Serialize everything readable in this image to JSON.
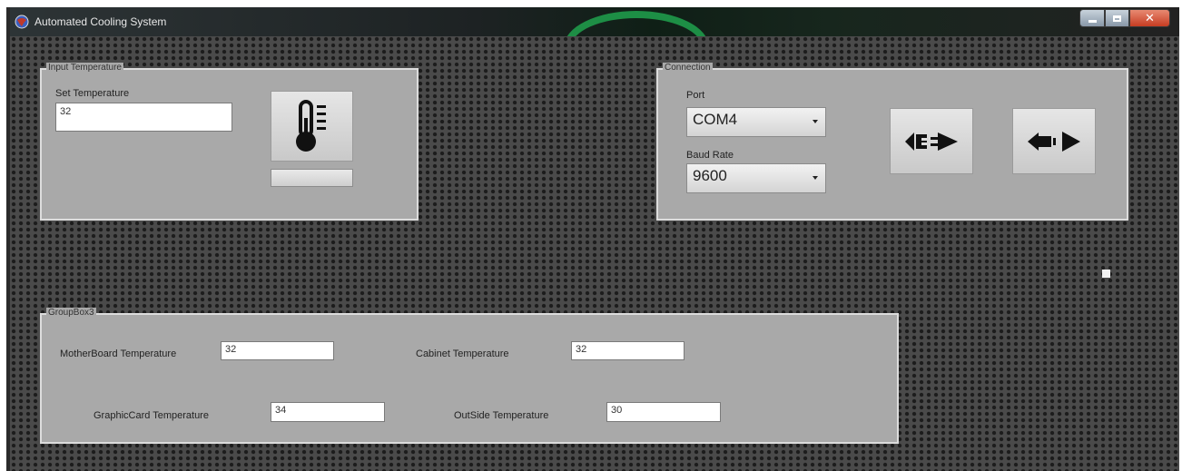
{
  "window": {
    "title": "Automated Cooling System",
    "icon": "app-globe-icon",
    "caption_buttons": [
      "minimize-icon",
      "maximize-icon",
      "close-icon"
    ]
  },
  "input_temperature": {
    "group_title": "Input Temperature",
    "set_label": "Set Temperature",
    "set_value": "32",
    "thermometer_icon": "thermometer-icon"
  },
  "connection": {
    "group_title": "Connection",
    "port_label": "Port",
    "port_value": "COM4",
    "baud_label": "Baud Rate",
    "baud_value": "9600",
    "connect_icon": "plug-connect-icon",
    "disconnect_icon": "plug-disconnect-icon"
  },
  "groupbox3": {
    "group_title": "GroupBox3",
    "motherboard_label": "MotherBoard Temperature",
    "motherboard_value": "32",
    "cabinet_label": "Cabinet Temperature",
    "cabinet_value": "32",
    "graphiccard_label": "GraphicCard Temperature",
    "graphiccard_value": "34",
    "outside_label": "OutSide Temperature",
    "outside_value": "30"
  },
  "colors": {
    "group_background": "#a9a9a9",
    "client_background": "#4a4a4a",
    "close_button": "#c63c22"
  }
}
